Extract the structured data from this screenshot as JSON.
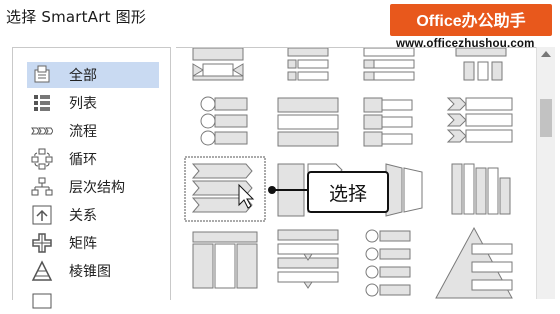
{
  "dialog": {
    "title": "选择 SmartArt 图形"
  },
  "watermark": {
    "brand": "Office办公助手",
    "url": "www.officezhushou.com"
  },
  "categories": [
    {
      "label": "全部",
      "icon": "all-icon",
      "selected": true
    },
    {
      "label": "列表",
      "icon": "list-icon"
    },
    {
      "label": "流程",
      "icon": "process-icon"
    },
    {
      "label": "循环",
      "icon": "cycle-icon"
    },
    {
      "label": "层次结构",
      "icon": "hierarchy-icon"
    },
    {
      "label": "关系",
      "icon": "relationship-icon"
    },
    {
      "label": "矩阵",
      "icon": "matrix-icon"
    },
    {
      "label": "棱锥图",
      "icon": "pyramid-icon"
    }
  ],
  "callout": {
    "label": "选择"
  },
  "colors": {
    "selection": "#c9daf2",
    "brand": "#e8581c",
    "shape_fill": "#e0e0e0",
    "shape_stroke": "#777777"
  }
}
